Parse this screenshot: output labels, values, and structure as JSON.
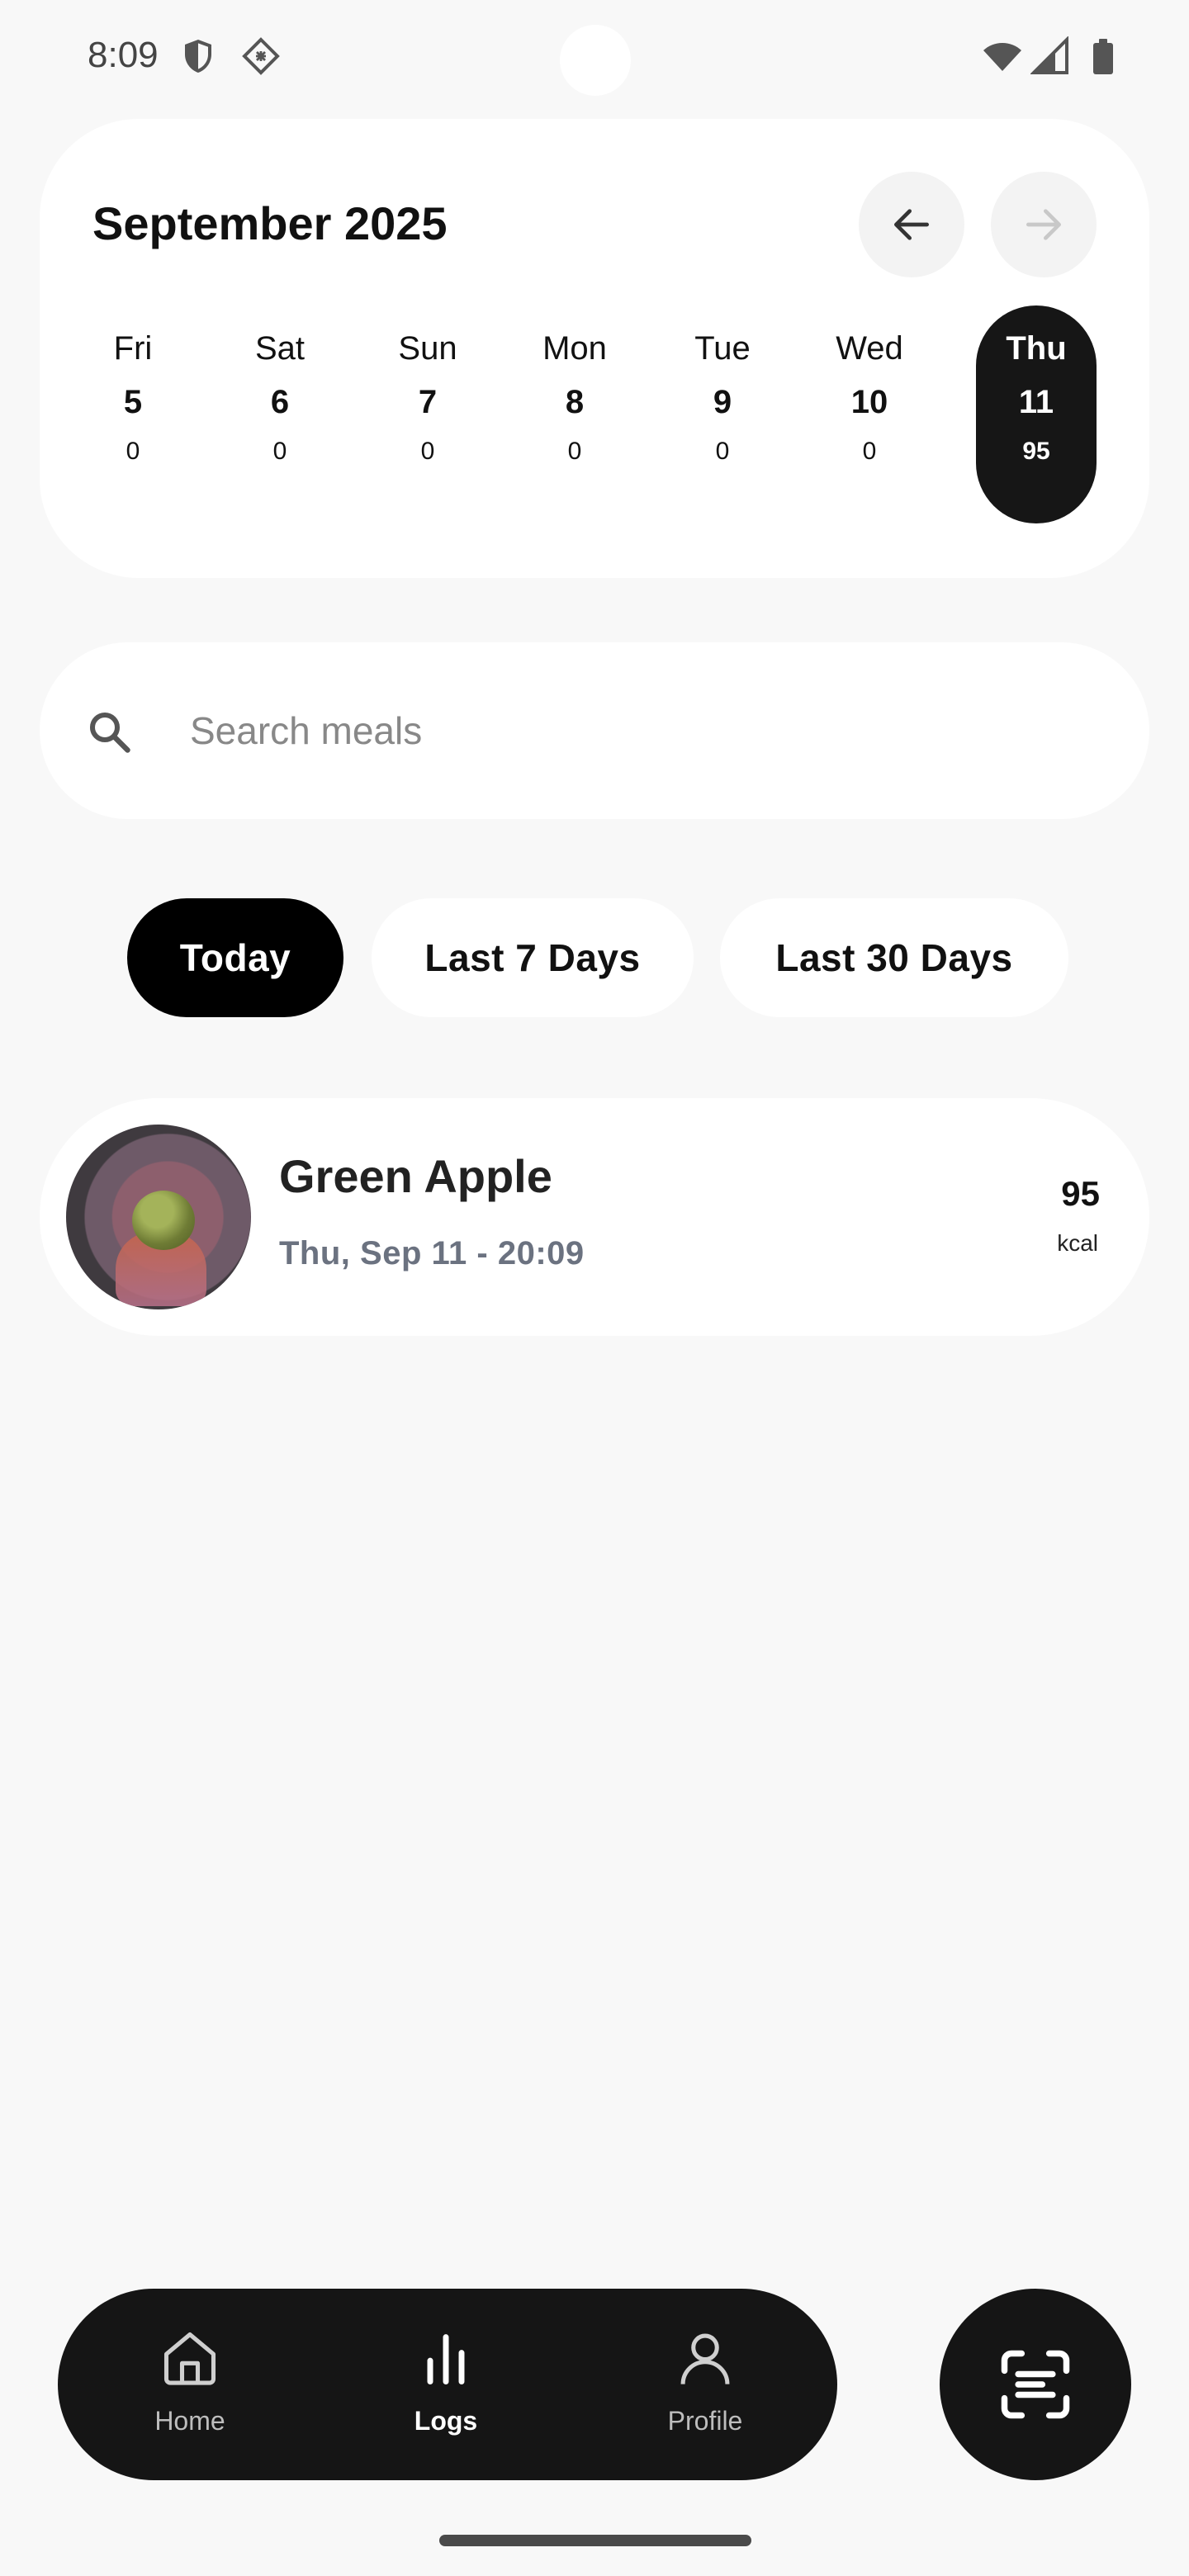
{
  "status_bar": {
    "time": "8:09",
    "icons": [
      "shield-icon",
      "vpn-diamond-icon",
      "wifi-icon",
      "signal-icon",
      "battery-icon"
    ]
  },
  "calendar": {
    "month_title": "September 2025",
    "prev_icon": "arrow-left-icon",
    "next_icon": "arrow-right-icon",
    "days": [
      {
        "name": "Fri",
        "num": "5",
        "kcal": "0"
      },
      {
        "name": "Sat",
        "num": "6",
        "kcal": "0"
      },
      {
        "name": "Sun",
        "num": "7",
        "kcal": "0"
      },
      {
        "name": "Mon",
        "num": "8",
        "kcal": "0"
      },
      {
        "name": "Tue",
        "num": "9",
        "kcal": "0"
      },
      {
        "name": "Wed",
        "num": "10",
        "kcal": "0"
      },
      {
        "name": "Thu",
        "num": "11",
        "kcal": "95"
      }
    ],
    "selected_day": "Thu"
  },
  "search": {
    "placeholder": "Search meals",
    "value": ""
  },
  "filters": {
    "items": [
      "Today",
      "Last 7 Days",
      "Last 30 Days"
    ],
    "active": "Today"
  },
  "meals": [
    {
      "name": "Green Apple",
      "time": "Thu, Sep 11 - 20:09",
      "kcal": "95",
      "kcal_unit": "kcal"
    }
  ],
  "bottom_nav": {
    "items": [
      {
        "label": "Home",
        "icon": "home-icon"
      },
      {
        "label": "Logs",
        "icon": "bar-chart-icon"
      },
      {
        "label": "Profile",
        "icon": "person-icon"
      }
    ],
    "active": "Logs"
  },
  "fab": {
    "icon": "scan-icon"
  },
  "colors": {
    "background": "#f8f8f8",
    "card": "#ffffff",
    "dark": "#151515",
    "muted_text": "#6b7280"
  }
}
